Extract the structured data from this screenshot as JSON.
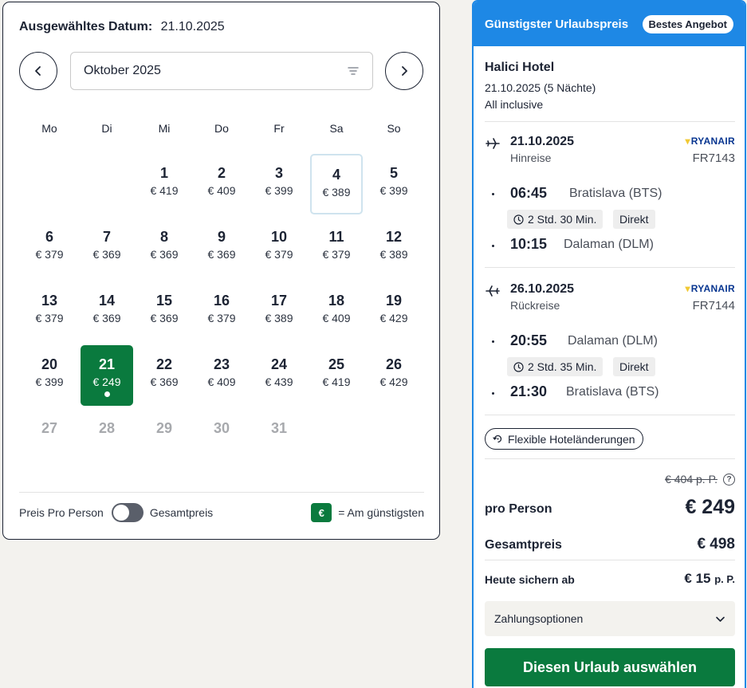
{
  "calendar": {
    "header_label": "Ausgewähltes Datum:",
    "header_value": "21.10.2025",
    "month": "Oktober 2025",
    "weekdays": [
      "Mo",
      "Di",
      "Mi",
      "Do",
      "Fr",
      "Sa",
      "So"
    ],
    "days": [
      {
        "num": "",
        "price": ""
      },
      {
        "num": "",
        "price": ""
      },
      {
        "num": "1",
        "price": "€ 419"
      },
      {
        "num": "2",
        "price": "€ 409"
      },
      {
        "num": "3",
        "price": "€ 399"
      },
      {
        "num": "4",
        "price": "€ 389",
        "state": "outlined"
      },
      {
        "num": "5",
        "price": "€ 399"
      },
      {
        "num": "6",
        "price": "€ 379"
      },
      {
        "num": "7",
        "price": "€ 369"
      },
      {
        "num": "8",
        "price": "€ 369"
      },
      {
        "num": "9",
        "price": "€ 369"
      },
      {
        "num": "10",
        "price": "€ 379"
      },
      {
        "num": "11",
        "price": "€ 379"
      },
      {
        "num": "12",
        "price": "€ 389"
      },
      {
        "num": "13",
        "price": "€ 379"
      },
      {
        "num": "14",
        "price": "€ 369"
      },
      {
        "num": "15",
        "price": "€ 369"
      },
      {
        "num": "16",
        "price": "€ 379"
      },
      {
        "num": "17",
        "price": "€ 389"
      },
      {
        "num": "18",
        "price": "€ 409"
      },
      {
        "num": "19",
        "price": "€ 429"
      },
      {
        "num": "20",
        "price": "€ 399"
      },
      {
        "num": "21",
        "price": "€ 249",
        "state": "selected"
      },
      {
        "num": "22",
        "price": "€ 369"
      },
      {
        "num": "23",
        "price": "€ 409"
      },
      {
        "num": "24",
        "price": "€ 439"
      },
      {
        "num": "25",
        "price": "€ 419"
      },
      {
        "num": "26",
        "price": "€ 429"
      },
      {
        "num": "27",
        "price": "",
        "state": "disabled"
      },
      {
        "num": "28",
        "price": "",
        "state": "disabled"
      },
      {
        "num": "29",
        "price": "",
        "state": "disabled"
      },
      {
        "num": "30",
        "price": "",
        "state": "disabled"
      },
      {
        "num": "31",
        "price": "",
        "state": "disabled"
      }
    ],
    "footer": {
      "per_person_label": "Preis Pro Person",
      "total_label": "Gesamtpreis",
      "legend_badge": "€",
      "legend_label": "= Am günstigsten"
    },
    "colors": {
      "selected": "#0a7a3e",
      "outlined": "#cfe3ee"
    }
  },
  "offer": {
    "title": "Günstigster Urlaubspreis",
    "badge": "Bestes Angebot",
    "hotel_name": "Halici Hotel",
    "hotel_date": "21.10.2025 (5 Nächte)",
    "board": "All inclusive",
    "outbound": {
      "date": "21.10.2025",
      "direction": "Hinreise",
      "airline": "RYANAIR",
      "flight_no": "FR7143",
      "dep_time": "06:45",
      "dep_place": "Bratislava (BTS)",
      "duration": "2 Std. 30 Min.",
      "stops": "Direkt",
      "arr_time": "10:15",
      "arr_place": "Dalaman (DLM)"
    },
    "inbound": {
      "date": "26.10.2025",
      "direction": "Rückreise",
      "airline": "RYANAIR",
      "flight_no": "FR7144",
      "dep_time": "20:55",
      "dep_place": "Dalaman (DLM)",
      "duration": "2 Std. 35 Min.",
      "stops": "Direkt",
      "arr_time": "21:30",
      "arr_place": "Bratislava (BTS)"
    },
    "flex_label": "Flexible Hoteländerungen",
    "old_price": "€ 404 p. P.",
    "info": "?",
    "per_person_label": "pro Person",
    "per_person_value": "€ 249",
    "total_label": "Gesamtpreis",
    "total_value": "€ 498",
    "secure_label": "Heute sichern ab",
    "secure_value": "€ 15",
    "secure_unit": "p. P.",
    "payment_label": "Zahlungsoptionen",
    "cta_label": "Diesen Urlaub auswählen",
    "colors": {
      "accent": "#1e88e5",
      "cta": "#0a7a3e"
    }
  }
}
